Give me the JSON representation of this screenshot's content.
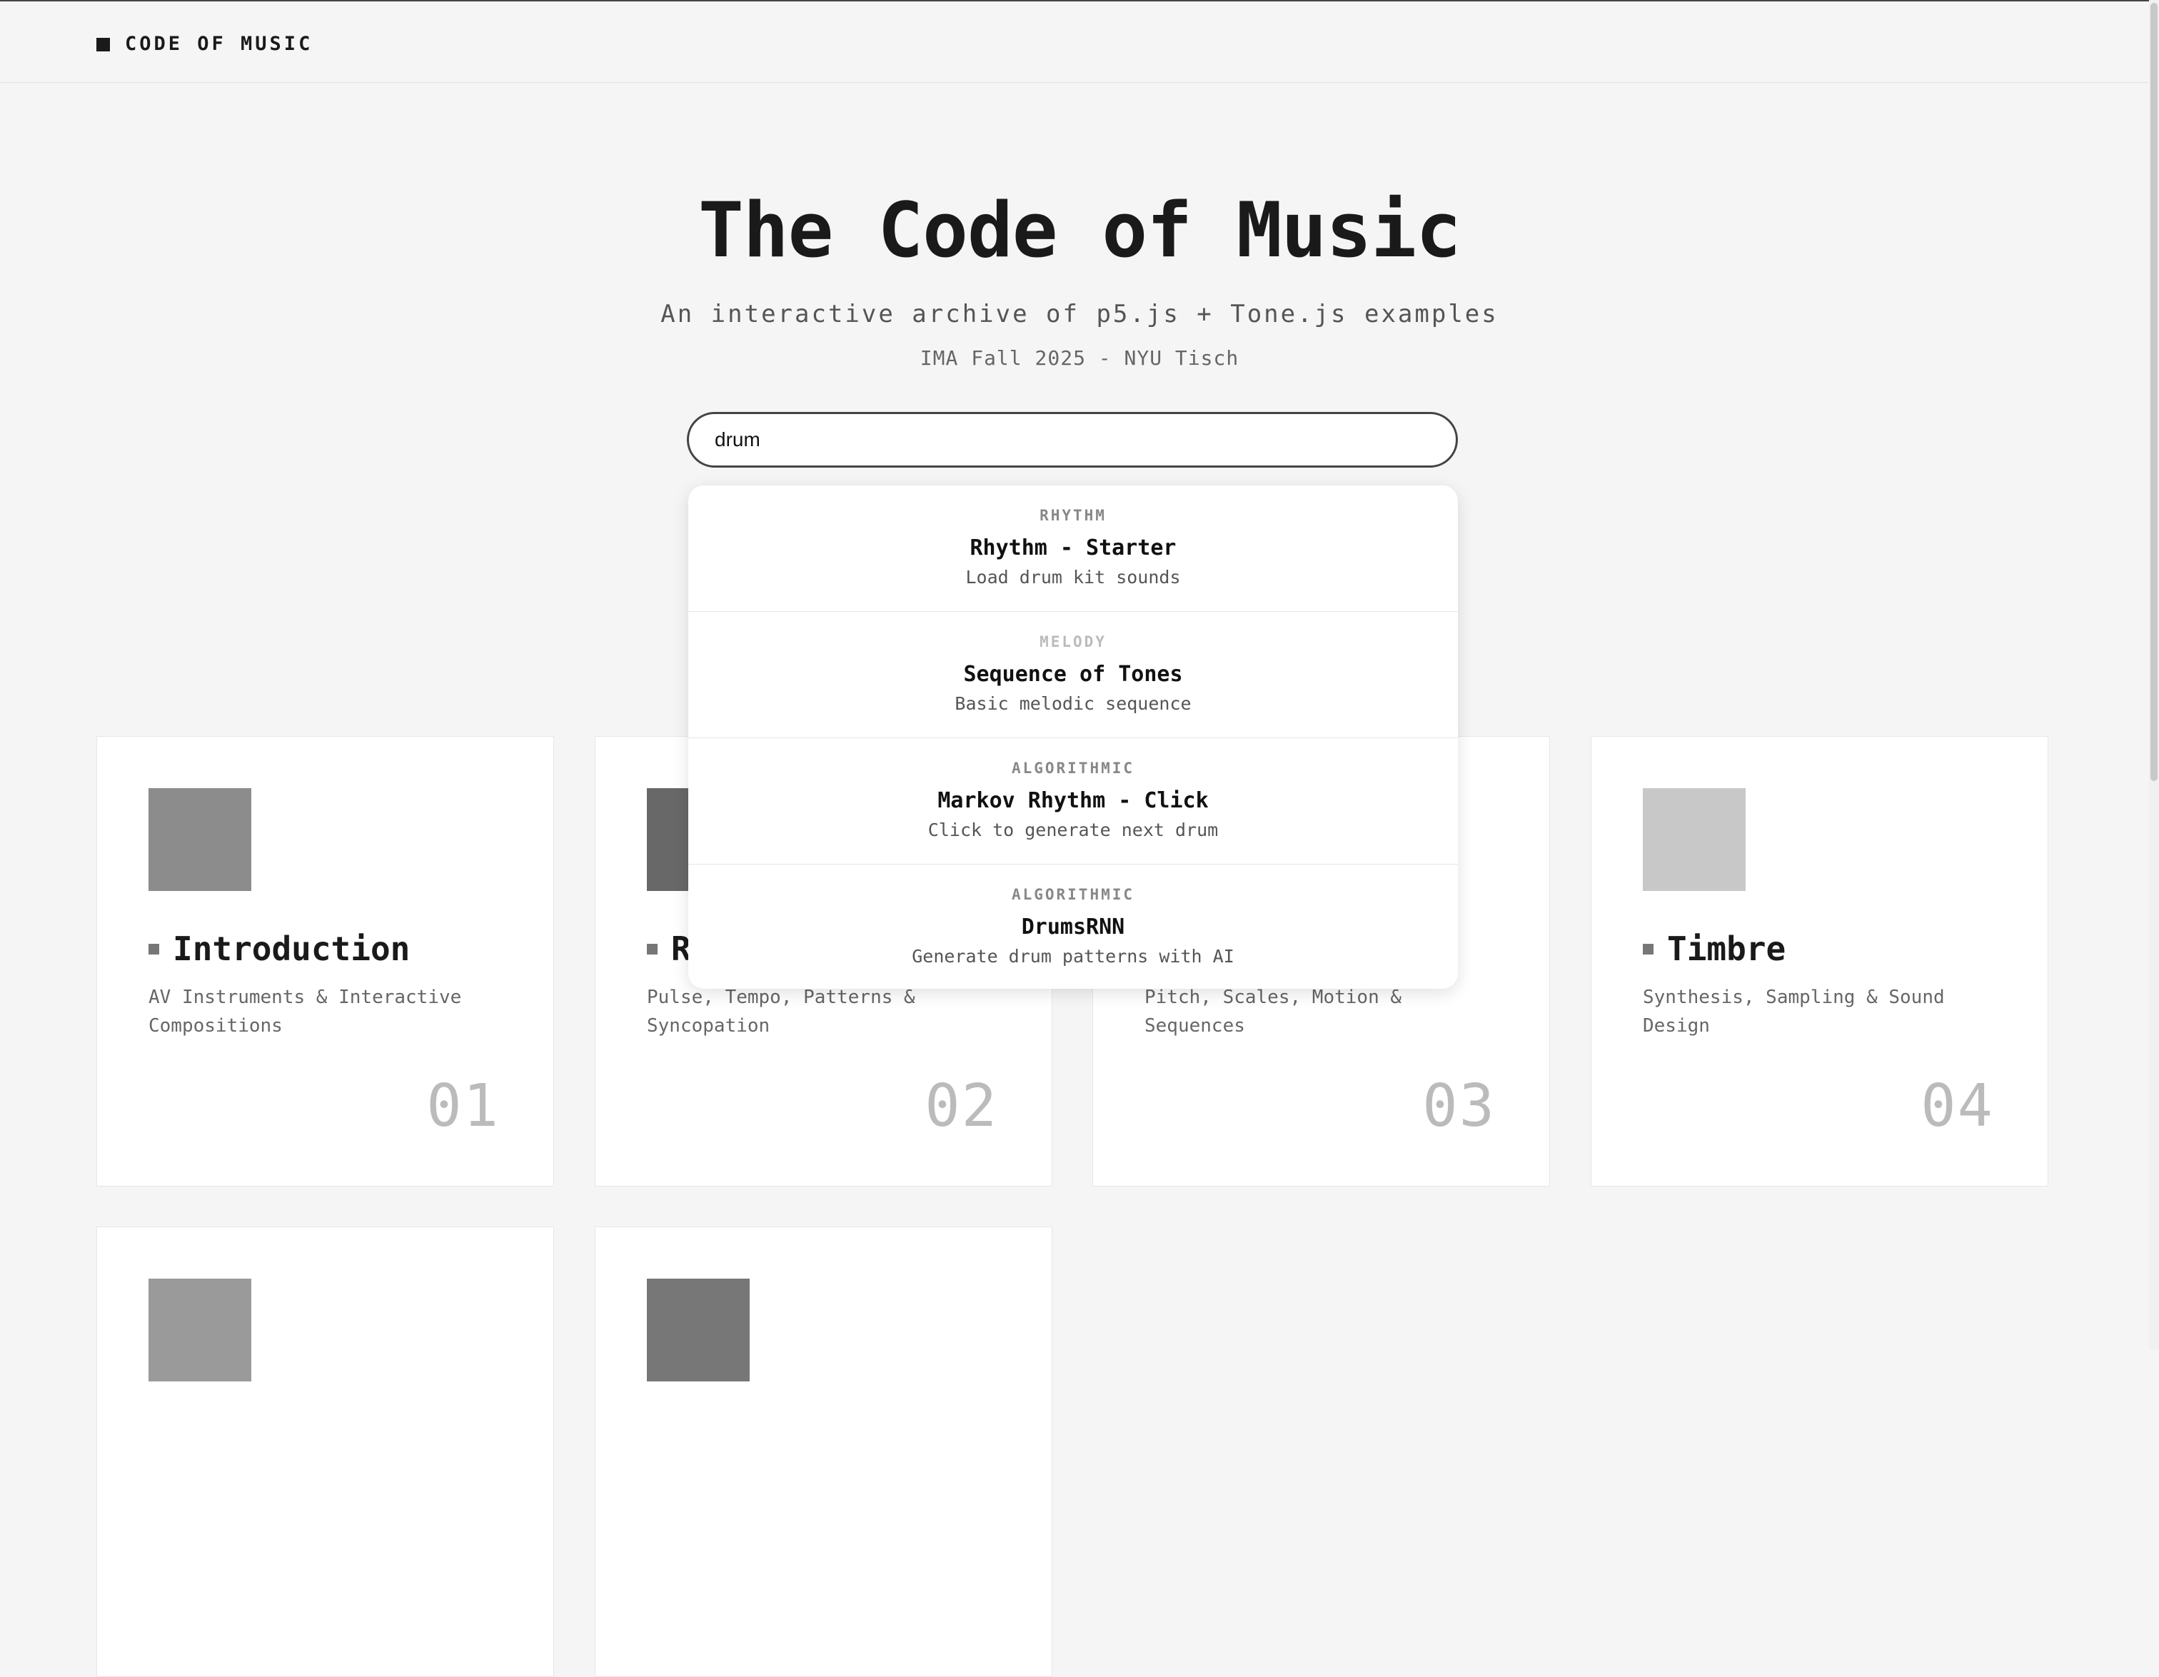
{
  "header": {
    "brand": "CODE OF MUSIC"
  },
  "hero": {
    "title": "The Code of Music",
    "subtitle": "An interactive archive of p5.js + Tone.js examples",
    "meta": "IMA Fall 2025 - NYU Tisch"
  },
  "search": {
    "value": "drum"
  },
  "results": [
    {
      "category": "RHYTHM",
      "title": "Rhythm - Starter",
      "desc": "Load drum kit sounds"
    },
    {
      "category": "MELODY",
      "title": "Sequence of Tones",
      "desc": "Basic melodic sequence"
    },
    {
      "category": "ALGORITHMIC",
      "title": "Markov Rhythm - Click",
      "desc": "Click to generate next drum"
    },
    {
      "category": "ALGORITHMIC",
      "title": "DrumsRNN",
      "desc": "Generate drum patterns with AI"
    }
  ],
  "cards": [
    {
      "title": "Introduction",
      "desc": "AV Instruments & Interactive Compositions",
      "num": "01",
      "color": "#8c8c8c"
    },
    {
      "title": "R",
      "desc": "Pulse, Tempo, Patterns & Syncopation",
      "num": "02",
      "color": "#686868"
    },
    {
      "title": "",
      "desc": "Pitch, Scales, Motion & Sequences",
      "num": "03",
      "color": "#a0a0a0"
    },
    {
      "title": "Timbre",
      "desc": "Synthesis, Sampling & Sound Design",
      "num": "04",
      "color": "#c8c8c8"
    },
    {
      "title": "",
      "desc": "",
      "num": "",
      "color": "#9a9a9a"
    },
    {
      "title": "",
      "desc": "",
      "num": "",
      "color": "#777777"
    }
  ]
}
